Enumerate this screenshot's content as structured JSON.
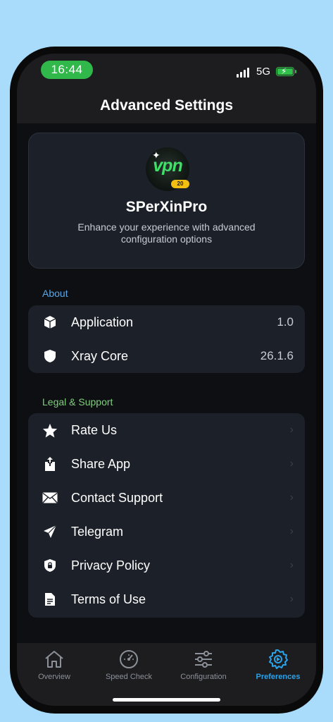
{
  "status": {
    "time": "16:44",
    "network": "5G"
  },
  "header": {
    "title": "Advanced Settings"
  },
  "card": {
    "logo_text": "vpn",
    "logo_badge": "20",
    "app_name": "SPerXinPro",
    "description": "Enhance your experience with advanced configuration options"
  },
  "about": {
    "label": "About",
    "items": [
      {
        "label": "Application",
        "value": "1.0",
        "icon": "cube-icon"
      },
      {
        "label": "Xray Core",
        "value": "26.1.6",
        "icon": "shield-icon"
      }
    ]
  },
  "legal": {
    "label": "Legal & Support",
    "items": [
      {
        "label": "Rate Us",
        "icon": "star-icon"
      },
      {
        "label": "Share App",
        "icon": "share-icon"
      },
      {
        "label": "Contact Support",
        "icon": "envelope-icon"
      },
      {
        "label": "Telegram",
        "icon": "paper-plane-icon"
      },
      {
        "label": "Privacy Policy",
        "icon": "lock-shield-icon"
      },
      {
        "label": "Terms of Use",
        "icon": "document-icon"
      }
    ]
  },
  "tabs": [
    {
      "label": "Overview",
      "icon": "home-icon",
      "active": false
    },
    {
      "label": "Speed Check",
      "icon": "speedometer-icon",
      "active": false
    },
    {
      "label": "Configuration",
      "icon": "sliders-icon",
      "active": false
    },
    {
      "label": "Preferences",
      "icon": "gear-icon",
      "active": true
    }
  ],
  "colors": {
    "background": "#a9dcfb",
    "accent_blue": "#2aa3ea",
    "accent_green": "#7fd07a",
    "status_green": "#30b84a",
    "card": "#1c2029"
  }
}
